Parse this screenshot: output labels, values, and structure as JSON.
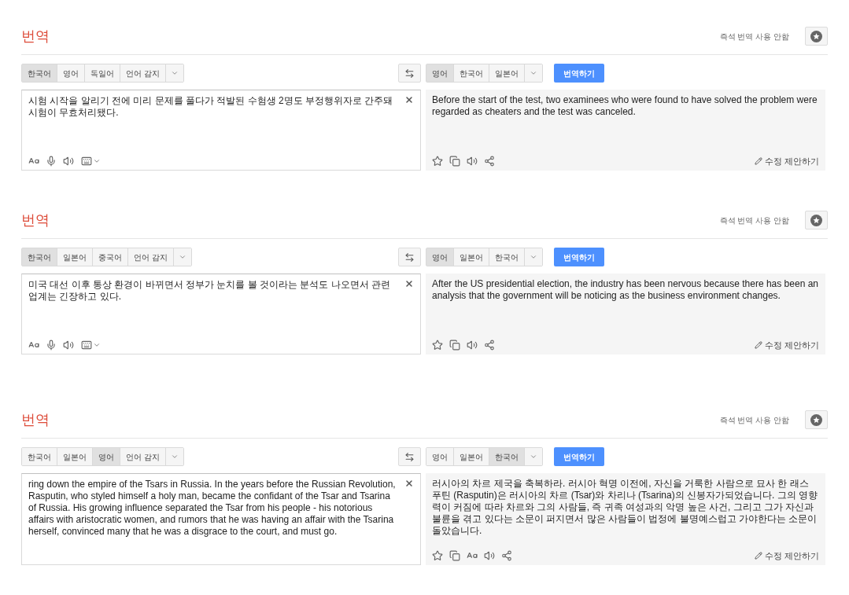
{
  "panels": [
    {
      "title": "번역",
      "instant_label": "즉석 번역 사용 안함",
      "source_tabs": [
        {
          "label": "한국어",
          "selected": true
        },
        {
          "label": "영어",
          "selected": false
        },
        {
          "label": "독일어",
          "selected": false
        },
        {
          "label": "언어 감지",
          "selected": false
        }
      ],
      "target_tabs": [
        {
          "label": "영어",
          "selected": true
        },
        {
          "label": "한국어",
          "selected": false
        },
        {
          "label": "일본어",
          "selected": false
        }
      ],
      "translate_button": "번역하기",
      "source_text": "시험 시작을 알리기 전에 미리 문제를 풀다가 적발된 수험생 2명도 부정행위자로 간주돼 시험이 무효처리됐다.",
      "source_tools": [
        {
          "kind": "font"
        },
        {
          "kind": "mic"
        },
        {
          "kind": "speaker"
        },
        {
          "kind": "keyboard"
        }
      ],
      "output_text": "Before the start of the test, two examinees who were found to have solved the problem were regarded as cheaters and the test was canceled.",
      "output_tools": [
        {
          "kind": "star"
        },
        {
          "kind": "copy"
        },
        {
          "kind": "speaker"
        },
        {
          "kind": "share"
        }
      ],
      "suggest_label": "수정 제안하기"
    },
    {
      "title": "번역",
      "instant_label": "즉석 번역 사용 안함",
      "source_tabs": [
        {
          "label": "한국어",
          "selected": true
        },
        {
          "label": "일본어",
          "selected": false
        },
        {
          "label": "중국어",
          "selected": false
        },
        {
          "label": "언어 감지",
          "selected": false
        }
      ],
      "target_tabs": [
        {
          "label": "영어",
          "selected": true
        },
        {
          "label": "일본어",
          "selected": false
        },
        {
          "label": "한국어",
          "selected": false
        }
      ],
      "translate_button": "번역하기",
      "source_text": "미국 대선 이후 통상 환경이 바뀌면서 정부가 눈치를 볼 것이라는 분석도 나오면서 관련 업계는 긴장하고 있다.",
      "source_tools": [
        {
          "kind": "font"
        },
        {
          "kind": "mic"
        },
        {
          "kind": "speaker"
        },
        {
          "kind": "keyboard"
        }
      ],
      "output_text": "After the US presidential election, the industry has been nervous because there has been an analysis that the government will be noticing as the business environment changes.",
      "output_tools": [
        {
          "kind": "star"
        },
        {
          "kind": "copy"
        },
        {
          "kind": "speaker"
        },
        {
          "kind": "share"
        }
      ],
      "suggest_label": "수정 제안하기"
    },
    {
      "title": "번역",
      "instant_label": "즉석 번역 사용 안함",
      "source_tabs": [
        {
          "label": "한국어",
          "selected": false
        },
        {
          "label": "일본어",
          "selected": false
        },
        {
          "label": "영어",
          "selected": true
        },
        {
          "label": "언어 감지",
          "selected": false
        }
      ],
      "target_tabs": [
        {
          "label": "영어",
          "selected": false
        },
        {
          "label": "일본어",
          "selected": false
        },
        {
          "label": "한국어",
          "selected": true
        }
      ],
      "translate_button": "번역하기",
      "source_text": "ring down the empire of the Tsars in Russia. In the years before the Russian Revolution, Rasputin, who styled himself a holy man, became the confidant of the Tsar and Tsarina of Russia. His growing influence separated the Tsar from his people - his notorious affairs with aristocratic women, and rumors that he was having an affair with the Tsarina herself, convinced many that he was a disgrace to the court, and must go.",
      "output_text": "러시아의 차르 제국을 축복하라. 러시아 혁명 이전에, 자신을 거룩한 사람으로 묘사 한 래스 푸틴 (Rasputin)은 러시아의 차르 (Tsar)와 차리나 (Tsarina)의 신봉자가되었습니다. 그의 영향력이 커짐에 따라 차르와 그의 사람들, 즉 귀족 여성과의 악명 높은 사건, 그리고 그가 자신과 불륜을 겪고 있다는 소문이 퍼지면서 많은 사람들이 법정에 불명예스럽고 가야한다는 소문이 돌았습니다.",
      "output_tools": [
        {
          "kind": "star"
        },
        {
          "kind": "copy"
        },
        {
          "kind": "font"
        },
        {
          "kind": "speaker"
        },
        {
          "kind": "share"
        }
      ],
      "suggest_label": "수정 제안하기"
    }
  ]
}
